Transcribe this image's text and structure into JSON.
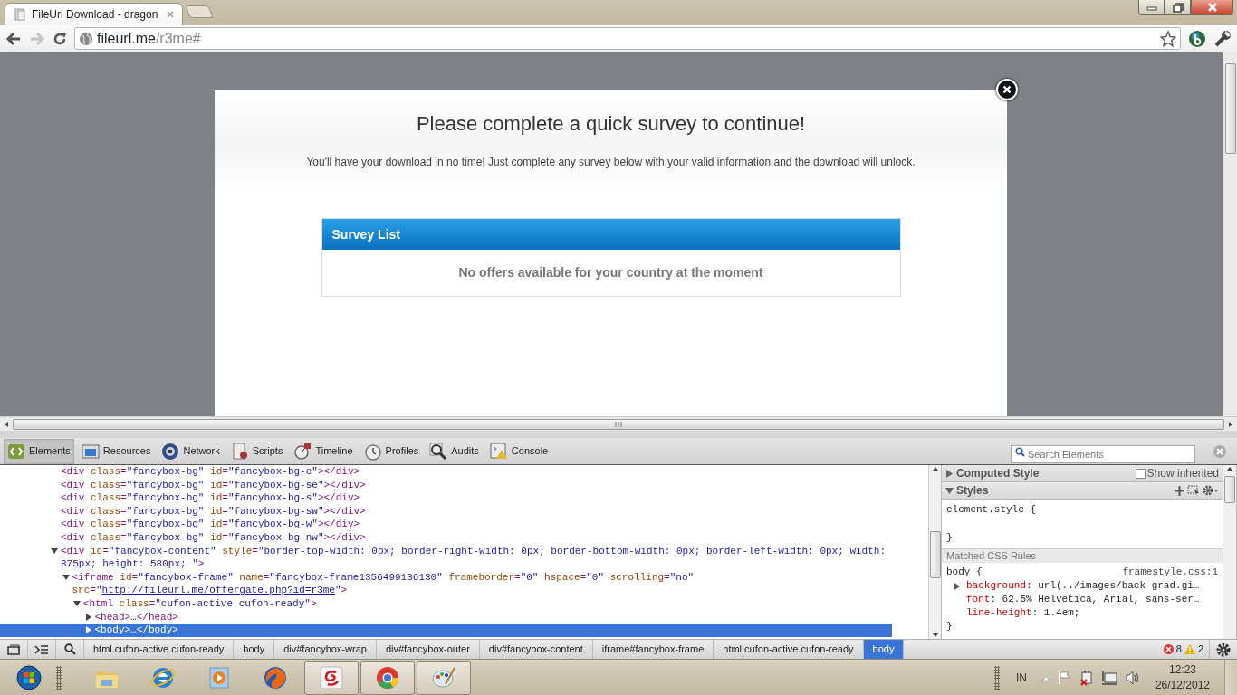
{
  "browser": {
    "tabs": [
      {
        "title": "FileUrl Download - dragon",
        "selected": true
      }
    ],
    "address": {
      "host": "fileurl.me",
      "path": "/r3me#"
    }
  },
  "page": {
    "modal": {
      "title": "Please complete a quick survey to continue!",
      "subtitle": "You'll have your download in no time! Just complete any survey below with your valid information and the download will unlock.",
      "survey_list": {
        "title": "Survey List",
        "message": "No offers available for your country at the moment"
      }
    }
  },
  "devtools": {
    "tabs": [
      {
        "label": "Elements",
        "selected": true
      },
      {
        "label": "Resources",
        "selected": false
      },
      {
        "label": "Network",
        "selected": false
      },
      {
        "label": "Scripts",
        "selected": false
      },
      {
        "label": "Timeline",
        "selected": false
      },
      {
        "label": "Profiles",
        "selected": false
      },
      {
        "label": "Audits",
        "selected": false
      },
      {
        "label": "Console",
        "selected": false
      }
    ],
    "search": {
      "placeholder": "Search Elements"
    },
    "dom": [
      {
        "kind": "leaf",
        "selected": false,
        "segments": [
          {
            "kind": "tag",
            "text": "<div "
          },
          {
            "kind": "attr",
            "text": "class"
          },
          {
            "kind": "tag",
            "text": "="
          },
          {
            "kind": "value",
            "text": "\"fancybox-bg\" "
          },
          {
            "kind": "attr",
            "text": "id"
          },
          {
            "kind": "tag",
            "text": "="
          },
          {
            "kind": "value",
            "text": "\"fancybox-bg-e\""
          },
          {
            "kind": "tag",
            "text": "></div>"
          }
        ]
      },
      {
        "kind": "leaf",
        "selected": false,
        "segments": [
          {
            "kind": "tag",
            "text": "<div "
          },
          {
            "kind": "attr",
            "text": "class"
          },
          {
            "kind": "tag",
            "text": "="
          },
          {
            "kind": "value",
            "text": "\"fancybox-bg\" "
          },
          {
            "kind": "attr",
            "text": "id"
          },
          {
            "kind": "tag",
            "text": "="
          },
          {
            "kind": "value",
            "text": "\"fancybox-bg-se\""
          },
          {
            "kind": "tag",
            "text": "></div>"
          }
        ]
      },
      {
        "kind": "leaf",
        "selected": false,
        "segments": [
          {
            "kind": "tag",
            "text": "<div "
          },
          {
            "kind": "attr",
            "text": "class"
          },
          {
            "kind": "tag",
            "text": "="
          },
          {
            "kind": "value",
            "text": "\"fancybox-bg\" "
          },
          {
            "kind": "attr",
            "text": "id"
          },
          {
            "kind": "tag",
            "text": "="
          },
          {
            "kind": "value",
            "text": "\"fancybox-bg-s\""
          },
          {
            "kind": "tag",
            "text": "></div>"
          }
        ]
      },
      {
        "kind": "leaf",
        "selected": false,
        "segments": [
          {
            "kind": "tag",
            "text": "<div "
          },
          {
            "kind": "attr",
            "text": "class"
          },
          {
            "kind": "tag",
            "text": "="
          },
          {
            "kind": "value",
            "text": "\"fancybox-bg\" "
          },
          {
            "kind": "attr",
            "text": "id"
          },
          {
            "kind": "tag",
            "text": "="
          },
          {
            "kind": "value",
            "text": "\"fancybox-bg-sw\""
          },
          {
            "kind": "tag",
            "text": "></div>"
          }
        ]
      },
      {
        "kind": "leaf",
        "selected": false,
        "segments": [
          {
            "kind": "tag",
            "text": "<div "
          },
          {
            "kind": "attr",
            "text": "class"
          },
          {
            "kind": "tag",
            "text": "="
          },
          {
            "kind": "value",
            "text": "\"fancybox-bg\" "
          },
          {
            "kind": "attr",
            "text": "id"
          },
          {
            "kind": "tag",
            "text": "="
          },
          {
            "kind": "value",
            "text": "\"fancybox-bg-w\""
          },
          {
            "kind": "tag",
            "text": "></div>"
          }
        ]
      },
      {
        "kind": "leaf",
        "selected": false,
        "segments": [
          {
            "kind": "tag",
            "text": "<div "
          },
          {
            "kind": "attr",
            "text": "class"
          },
          {
            "kind": "tag",
            "text": "="
          },
          {
            "kind": "value",
            "text": "\"fancybox-bg\" "
          },
          {
            "kind": "attr",
            "text": "id"
          },
          {
            "kind": "tag",
            "text": "="
          },
          {
            "kind": "value",
            "text": "\"fancybox-bg-nw\""
          },
          {
            "kind": "tag",
            "text": "></div>"
          }
        ]
      },
      {
        "kind": "parent",
        "expanded": true,
        "selected": false,
        "segments": [
          {
            "kind": "tag",
            "text": "<div "
          },
          {
            "kind": "attr",
            "text": "id"
          },
          {
            "kind": "tag",
            "text": "="
          },
          {
            "kind": "value",
            "text": "\"fancybox-content\" "
          },
          {
            "kind": "attr",
            "text": "style"
          },
          {
            "kind": "tag",
            "text": "="
          },
          {
            "kind": "value",
            "text": "\"border-top-width: 0px; border-right-width: 0px; border-bottom-width: 0px; border-left-width: 0px; width: 875px; height: 580px; \""
          },
          {
            "kind": "tag",
            "text": ">"
          }
        ],
        "children": [
          {
            "kind": "parent",
            "expanded": true,
            "selected": false,
            "segments": [
              {
                "kind": "tag",
                "text": "<iframe "
              },
              {
                "kind": "attr",
                "text": "id"
              },
              {
                "kind": "tag",
                "text": "="
              },
              {
                "kind": "value",
                "text": "\"fancybox-frame\" "
              },
              {
                "kind": "attr",
                "text": "name"
              },
              {
                "kind": "tag",
                "text": "="
              },
              {
                "kind": "value",
                "text": "\"fancybox-frame1356499136130\" "
              },
              {
                "kind": "attr",
                "text": "frameborder"
              },
              {
                "kind": "tag",
                "text": "="
              },
              {
                "kind": "value",
                "text": "\"0\" "
              },
              {
                "kind": "attr",
                "text": "hspace"
              },
              {
                "kind": "tag",
                "text": "="
              },
              {
                "kind": "value",
                "text": "\"0\" "
              },
              {
                "kind": "attr",
                "text": "scrolling"
              },
              {
                "kind": "tag",
                "text": "="
              },
              {
                "kind": "value",
                "text": "\"no\" "
              },
              {
                "kind": "attr",
                "text": "src"
              },
              {
                "kind": "tag",
                "text": "="
              },
              {
                "kind": "value",
                "text": "\""
              },
              {
                "kind": "link",
                "text": "http://fileurl.me/offergate.php?id=r3me"
              },
              {
                "kind": "value",
                "text": "\""
              },
              {
                "kind": "tag",
                "text": ">"
              }
            ],
            "children": [
              {
                "kind": "parent",
                "expanded": true,
                "selected": false,
                "segments": [
                  {
                    "kind": "tag",
                    "text": "<html "
                  },
                  {
                    "kind": "attr",
                    "text": "class"
                  },
                  {
                    "kind": "tag",
                    "text": "="
                  },
                  {
                    "kind": "value",
                    "text": "\"cufon-active cufon-ready\""
                  },
                  {
                    "kind": "tag",
                    "text": ">"
                  }
                ],
                "children": [
                  {
                    "kind": "parent",
                    "expanded": false,
                    "selected": false,
                    "segments": [
                      {
                        "kind": "tag",
                        "text": "<head>"
                      },
                      {
                        "kind": "text",
                        "text": "…"
                      },
                      {
                        "kind": "tag",
                        "text": "</head>"
                      }
                    ]
                  },
                  {
                    "kind": "parent",
                    "expanded": false,
                    "selected": true,
                    "segments": [
                      {
                        "kind": "tag",
                        "text": "<body>"
                      },
                      {
                        "kind": "text",
                        "text": "…"
                      },
                      {
                        "kind": "tag",
                        "text": "</body>"
                      }
                    ]
                  }
                ]
              }
            ]
          }
        ]
      }
    ],
    "sidebar": {
      "computed": {
        "title": "Computed Style",
        "expanded": false,
        "show_inherited": {
          "label": "Show inherited",
          "checked": false
        }
      },
      "styles": {
        "title": "Styles",
        "expanded": true,
        "element_style": {
          "open": "element.style {",
          "close": "}"
        },
        "matched_title": "Matched CSS Rules",
        "rules": [
          {
            "selector": "body {",
            "source": "framestyle.css:1",
            "close": "}",
            "properties": [
              {
                "name": "background",
                "value": ": url(../images/back-grad.gi…",
                "expandable": true
              },
              {
                "name": "font",
                "value": ": 62.5% Helvetica, Arial, sans-ser…",
                "expandable": false
              },
              {
                "name": "line-height",
                "value": ": 1.4em;",
                "expandable": false
              }
            ]
          }
        ]
      }
    },
    "breadcrumbs": [
      {
        "label": "html.cufon-active.cufon-ready",
        "selected": false
      },
      {
        "label": "body",
        "selected": false
      },
      {
        "label": "div#fancybox-wrap",
        "selected": false
      },
      {
        "label": "div#fancybox-outer",
        "selected": false
      },
      {
        "label": "div#fancybox-content",
        "selected": false
      },
      {
        "label": "iframe#fancybox-frame",
        "selected": false
      },
      {
        "label": "html.cufon-active.cufon-ready",
        "selected": false
      },
      {
        "label": "body",
        "selected": true
      }
    ],
    "errors": "8",
    "warnings": "2"
  },
  "taskbar": {
    "apps": [
      {
        "running": false
      },
      {
        "running": false
      },
      {
        "running": false
      },
      {
        "running": false
      },
      {
        "running": true
      },
      {
        "running": true
      },
      {
        "running": true
      }
    ],
    "language": "IN",
    "time": "12:23",
    "date": "26/12/2012"
  }
}
